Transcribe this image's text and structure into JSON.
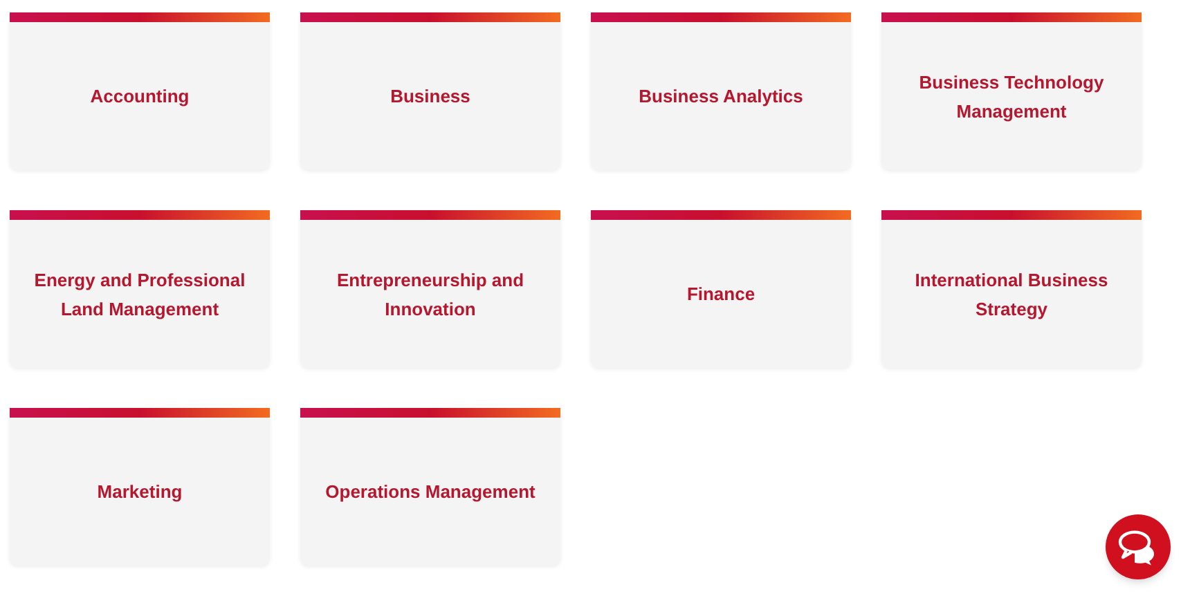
{
  "programs": [
    {
      "label": "Accounting"
    },
    {
      "label": "Business"
    },
    {
      "label": "Business Analytics"
    },
    {
      "label": "Business Technology Management"
    },
    {
      "label": "Energy and Professional Land Management"
    },
    {
      "label": "Entrepreneurship and Innovation"
    },
    {
      "label": "Finance"
    },
    {
      "label": "International Business Strategy"
    },
    {
      "label": "Marketing"
    },
    {
      "label": "Operations Management"
    }
  ]
}
